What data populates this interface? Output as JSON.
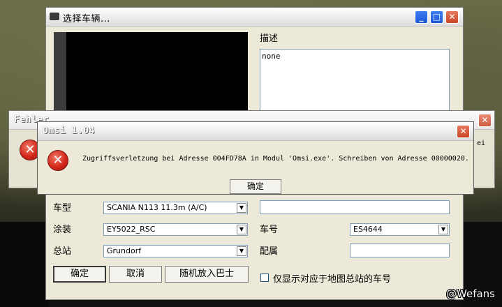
{
  "main_window": {
    "title": "选择车辆...",
    "desc_label": "描述",
    "desc_value": "none",
    "type_label": "车型",
    "type_value": "SCANIA N113 11.3m (A/C)",
    "livery_label": "涂装",
    "livery_value": "EY5022_RSC",
    "depot_label": "总站",
    "depot_value": "Grundorf",
    "number_label": "车号",
    "number_value": "ES4644",
    "assign_label": "配属",
    "assign_value": "",
    "ok_button": "确定",
    "cancel_button": "取消",
    "random_button": "随机放入巴士",
    "filter_checkbox_label": "仅显示对应于地图总站的车号"
  },
  "behind_dialog": {
    "title": "Fehler",
    "right_fragment": "ei"
  },
  "error_dialog": {
    "title": "Omsi 1.04",
    "message": "Zugriffsverletzung bei Adresse 004FD78A in Modul 'Omsi.exe'. Schreiben von Adresse 00000020.",
    "ok_button": "确定"
  },
  "watermark": "@Wefans",
  "icons": {
    "app_icon": "bus-icon",
    "minimize": "minimize-icon",
    "maximize": "maximize-icon",
    "close": "close-icon",
    "error": "error-icon"
  },
  "colors": {
    "window_bg": "#ece9d8",
    "close_red": "#c84525",
    "title_blue": "#1d56d6",
    "error_red": "#d4291b"
  }
}
